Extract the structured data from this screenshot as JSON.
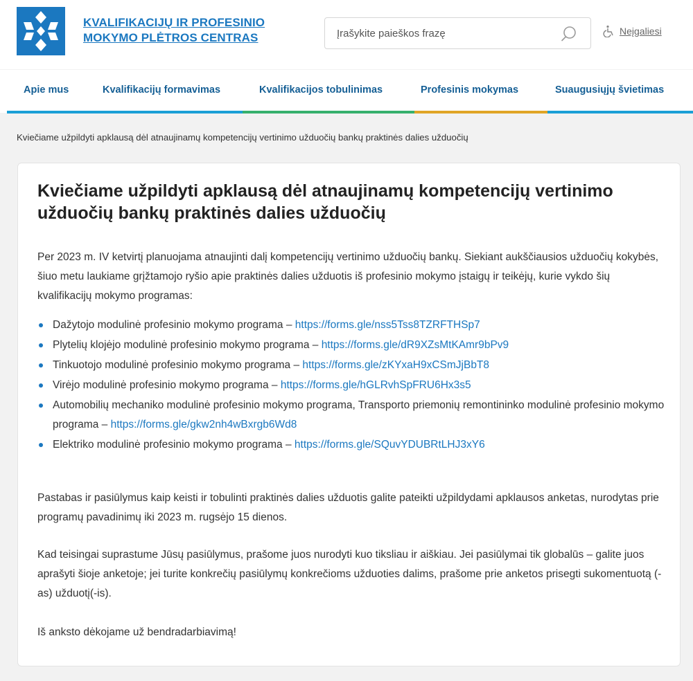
{
  "header": {
    "org_name_line1": "KVALIFIKACIJŲ IR PROFESINIO",
    "org_name_line2": "MOKYMO PLĖTROS CENTRAS",
    "search_placeholder": "Įrašykite paieškos frazę",
    "search_icon": "search-icon",
    "accessibility_label": "Neįgaliesi",
    "brand_color": "#1b78c0"
  },
  "nav": {
    "items": [
      {
        "label": "Apie mus",
        "bar_color": "#1b9fd6"
      },
      {
        "label": "Kvalifikacijų formavimas",
        "bar_color": "#1b9fd6"
      },
      {
        "label": "Kvalifikacijos tobulinimas",
        "bar_color": "#37b06d"
      },
      {
        "label": "Profesinis mokymas",
        "bar_color": "#e0a526"
      },
      {
        "label": "Suaugusiųjų švietimas",
        "bar_color": "#1b9fd6"
      }
    ]
  },
  "breadcrumb": "Kviečiame užpildyti apklausą dėl atnaujinamų kompetencijų vertinimo užduočių bankų praktinės dalies užduočių",
  "article": {
    "title": "Kviečiame užpildyti apklausą dėl atnaujinamų kompetencijų vertinimo užduočių bankų praktinės dalies užduočių",
    "intro": "Per 2023 m. IV ketvirtį planuojama atnaujinti dalį kompetencijų vertinimo užduočių bankų. Siekiant aukščiausios užduočių kokybės, šiuo metu laukiame grįžtamojo ryšio apie praktinės dalies užduotis iš profesinio mokymo įstaigų ir teikėjų, kurie vykdo šių kvalifikacijų mokymo programas:",
    "list": [
      {
        "text": "Dažytojo modulinė profesinio mokymo programa – ",
        "link": "https://forms.gle/nss5Tss8TZRFTHSp7"
      },
      {
        "text": "Plytelių klojėjo modulinė profesinio mokymo programa – ",
        "link": "https://forms.gle/dR9XZsMtKAmr9bPv9"
      },
      {
        "text": "Tinkuotojo modulinė profesinio mokymo programa – ",
        "link": "https://forms.gle/zKYxaH9xCSmJjBbT8"
      },
      {
        "text": "Virėjo modulinė profesinio mokymo programa – ",
        "link": "https://forms.gle/hGLRvhSpFRU6Hx3s5"
      },
      {
        "text": "Automobilių mechaniko modulinė profesinio mokymo programa, Transporto priemonių remontininko modulinė profesinio mokymo programa – ",
        "link": "https://forms.gle/gkw2nh4wBxrgb6Wd8"
      },
      {
        "text": "Elektriko modulinė profesinio mokymo programa – ",
        "link": "https://forms.gle/SQuvYDUBRtLHJ3xY6"
      }
    ],
    "para2": "Pastabas ir pasiūlymus kaip keisti ir tobulinti praktinės dalies užduotis galite pateikti užpildydami apklausos anketas, nurodytas prie programų pavadinimų iki 2023 m. rugsėjo 15 dienos.",
    "para3": "Kad teisingai suprastume Jūsų pasiūlymus, prašome juos nurodyti kuo tiksliau ir aiškiau. Jei pasiūlymai tik globalūs – galite juos aprašyti šioje anketoje; jei turite konkrečių pasiūlymų konkrečioms užduoties dalims, prašome prie anketos prisegti sukomentuotą (-as) užduotį(-is).",
    "para4": "Iš anksto dėkojame už bendradarbiavimą!",
    "link_color": "#1b78c0"
  }
}
